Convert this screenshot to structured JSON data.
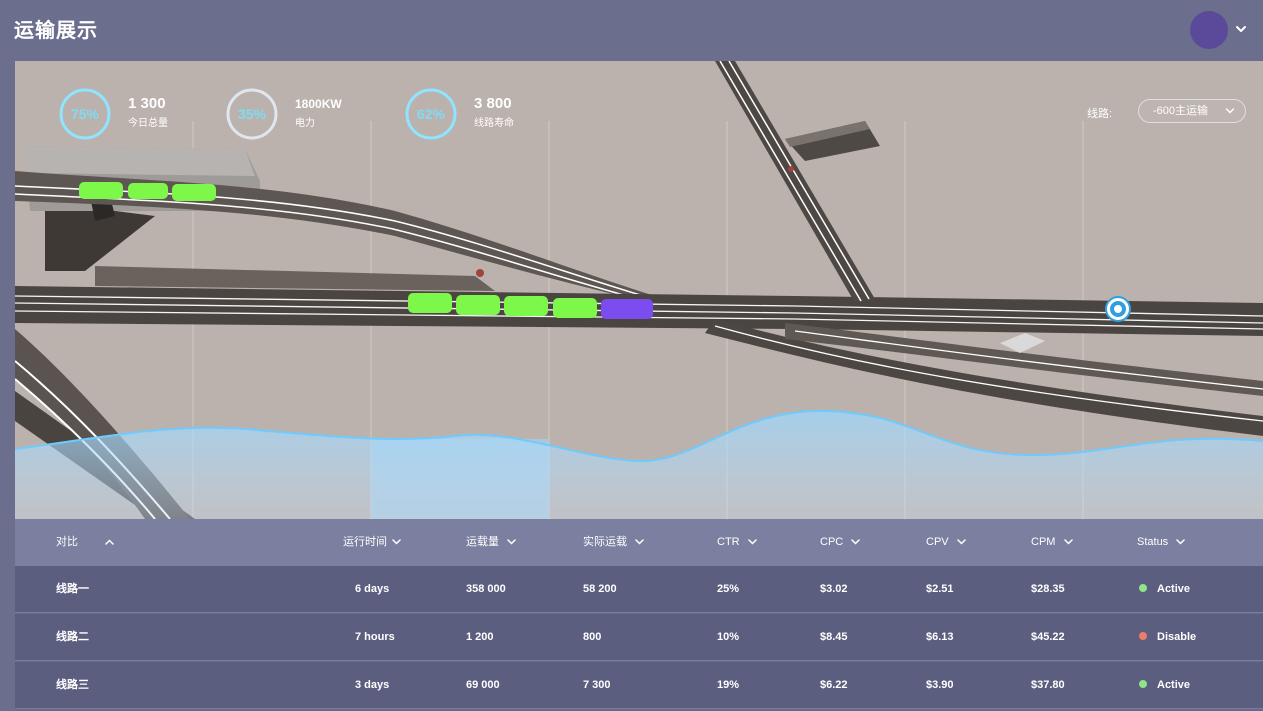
{
  "header": {
    "title": "运输展示"
  },
  "kpis": [
    {
      "percent": "75%",
      "value": "1 300",
      "label": "今日总量",
      "ring_color": "#8fe4ff"
    },
    {
      "percent": "35%",
      "value": "1800KW",
      "label": "电力",
      "ring_color": "#dfe6ef"
    },
    {
      "percent": "62%",
      "value": "3 800",
      "label": "线路寿命",
      "ring_color": "#8fe4ff"
    }
  ],
  "route_filter": {
    "label": "线路:",
    "selected": "-600主运输"
  },
  "table": {
    "columns": [
      "对比",
      "运行时间",
      "运载量",
      "实际运载",
      "CTR",
      "CPC",
      "CPV",
      "CPM",
      "Status"
    ],
    "rows": [
      {
        "name": "线路一",
        "run_time": "6 days",
        "capacity": "358 000",
        "actual": "58 200",
        "ctr": "25%",
        "cpc": "$3.02",
        "cpv": "$2.51",
        "cpm": "$28.35",
        "status": "Active"
      },
      {
        "name": "线路二",
        "run_time": "7 hours",
        "capacity": "1 200",
        "actual": "800",
        "ctr": "10%",
        "cpc": "$8.45",
        "cpv": "$6.13",
        "cpm": "$45.22",
        "status": "Disable"
      },
      {
        "name": "线路三",
        "run_time": "3 days",
        "capacity": "69 000",
        "actual": "7 300",
        "ctr": "19%",
        "cpc": "$6.22",
        "cpv": "$3.90",
        "cpm": "$37.80",
        "status": "Active"
      }
    ]
  },
  "colors": {
    "active": "#8ee58a",
    "disable": "#ee7c6a",
    "train_green": "#7cf74a",
    "train_purple": "#7b4cf0",
    "wave": "#8fd6ff"
  }
}
